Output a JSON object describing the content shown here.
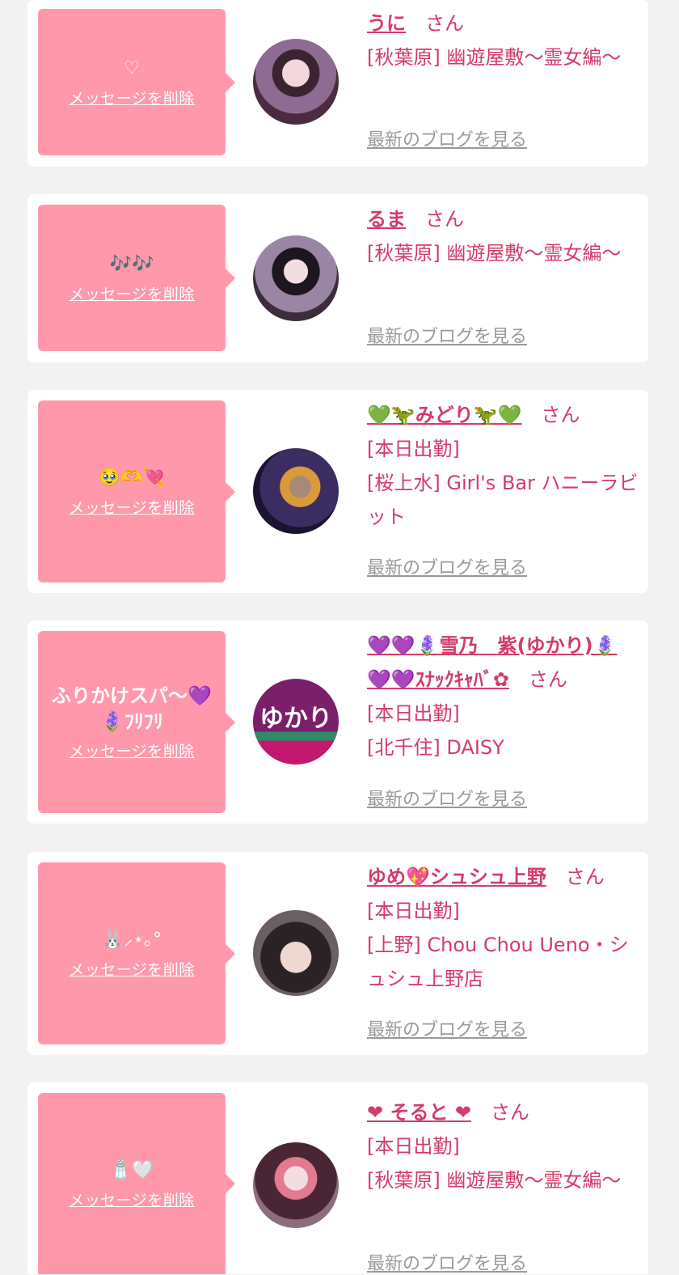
{
  "delete_label": "メッセージを削除",
  "blog_label": "最新のブログを見る",
  "san_label": "さん",
  "items": [
    {
      "message": "♡",
      "name": "うに",
      "lines": [
        "[秋葉原] 幽遊屋敷〜霊女編〜"
      ]
    },
    {
      "message": "🎶🎶",
      "name": "るま",
      "lines": [
        "[秋葉原] 幽遊屋敷〜霊女編〜"
      ]
    },
    {
      "message": "🥹🫶💘",
      "name": "💚🦖みどり🦖💚",
      "lines": [
        "[本日出勤]",
        "[桜上水] Girl's Bar ハニーラビット"
      ]
    },
    {
      "message": "ふりかけスパ〜💜🪻ﾌﾘﾌﾘ",
      "name": "💜💜🪻雪乃　紫(ゆかり)🪻💜💜ｽﾅｯｸｷｬﾊﾞ✿",
      "avatar_text": "ゆかり",
      "lines": [
        "[本日出勤]",
        "[北千住] DAISY"
      ]
    },
    {
      "message": "🐰⸝⋆｡°",
      "name": "ゆめ💖シュシュ上野",
      "lines": [
        "[本日出勤]",
        "[上野] Chou Chou Ueno・シュシュ上野店"
      ]
    },
    {
      "message": "🧂🤍",
      "name": "❤ そると ❤",
      "lines": [
        "[本日出勤]",
        "[秋葉原] 幽遊屋敷〜霊女編〜"
      ]
    }
  ]
}
